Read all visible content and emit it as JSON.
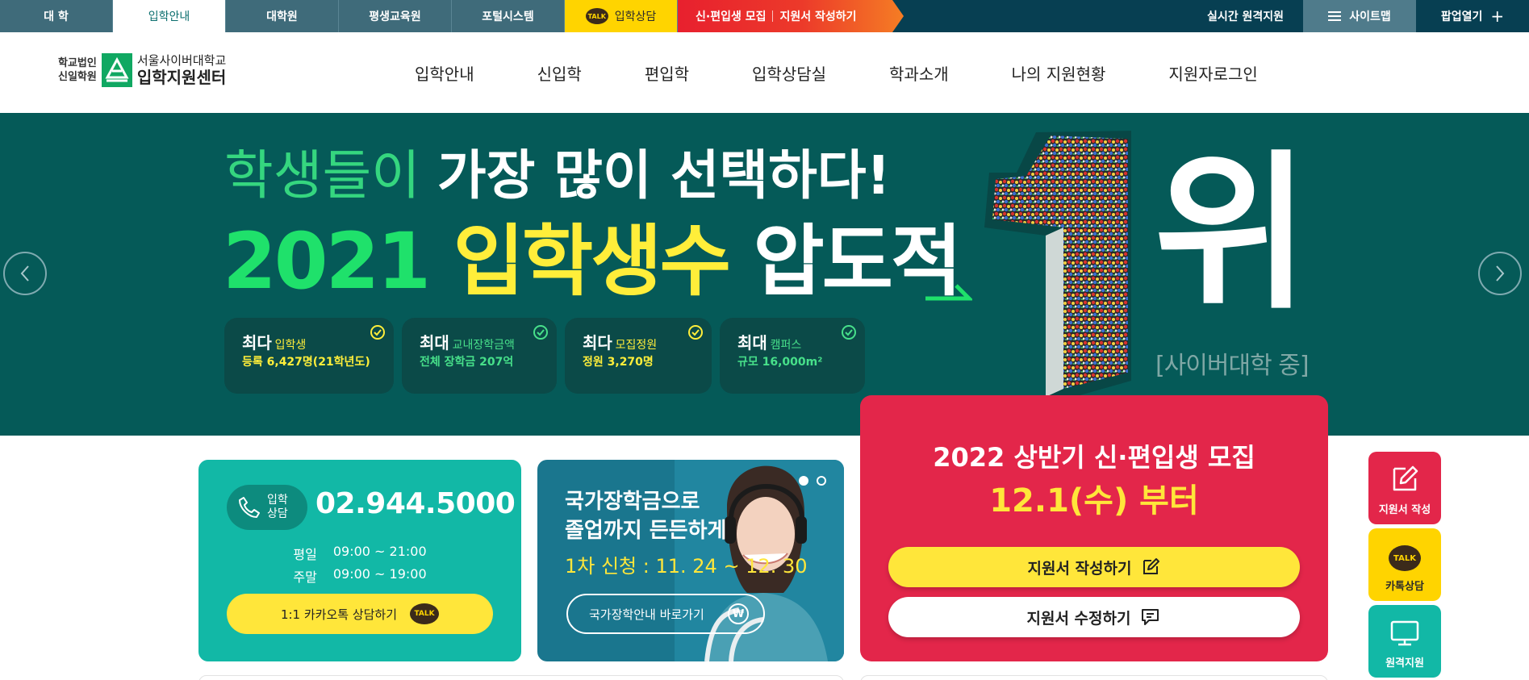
{
  "topbar": {
    "tabs": [
      {
        "label": "대 학"
      },
      {
        "label": "입학안내"
      },
      {
        "label": "대학원"
      },
      {
        "label": "평생교육원"
      },
      {
        "label": "포털시스템"
      }
    ],
    "counsel": {
      "badge": "TALK",
      "label": "입학상담"
    },
    "promo": {
      "recruit": "신·편입생 모집",
      "apply": "지원서 작성하기"
    },
    "remote_apply": "실시간 원격지원",
    "sitemap": "사이트맵",
    "popup": "팝업열기"
  },
  "header": {
    "logo": {
      "corp_line1": "학교법인",
      "corp_line2": "신일학원",
      "university": "서울사이버대학교",
      "center": "입학지원센터"
    },
    "nav": [
      "입학안내",
      "신입학",
      "편입학",
      "입학상담실",
      "학과소개",
      "나의 지원현황",
      "지원자로그인"
    ]
  },
  "hero": {
    "line1_thin": "학생들이",
    "line1_bold": "가장 많이 선택하다!",
    "year": "2021",
    "line2_yellow": "입학생수",
    "line2_white": "압도적",
    "rank_digit": "1",
    "rank_word": "위",
    "rank_note": "[사이버대학 중]",
    "stats": [
      {
        "max": "최다",
        "label": "입학생",
        "value": "등록 6,427명(21학년도)",
        "tone": "yellow"
      },
      {
        "max": "최대",
        "label": "교내장학금액",
        "value": "전체 장학금 207억",
        "tone": "green"
      },
      {
        "max": "최다",
        "label": "모집정원",
        "value": "정원 3,270명",
        "tone": "yellow"
      },
      {
        "max": "최대",
        "label": "캠퍼스",
        "value": "규모 16,000m²",
        "tone": "green"
      }
    ]
  },
  "phone": {
    "pill_line1": "입학",
    "pill_line2": "상담",
    "number": "02.944.5000",
    "hours": [
      {
        "day": "평일",
        "time": "09:00 ~ 21:00"
      },
      {
        "day": "주말",
        "time": "09:00 ~ 19:00"
      }
    ],
    "kakao_label": "1:1 카카오톡 상담하기",
    "kakao_badge": "TALK"
  },
  "scholarship": {
    "head_line1": "국가장학금으로",
    "head_line2": "졸업까지 든든하게",
    "period": "1차 신청 : 11. 24  ~  12. 30",
    "button": "국가장학안내 바로가기",
    "won_symbol": "₩"
  },
  "apply": {
    "title": "2022 상반기 신·편입생 모집",
    "date": "12.1(수) 부터",
    "write_button": "지원서 작성하기",
    "edit_button": "지원서 수정하기"
  },
  "quick_menu": [
    {
      "label": "지원서 작성",
      "icon": "edit-icon"
    },
    {
      "label": "카톡상담",
      "icon": "kakao-talk-icon",
      "badge": "TALK"
    },
    {
      "label": "원격지원",
      "icon": "monitor-icon"
    }
  ],
  "colors": {
    "topbar_bg": "#073f52",
    "hero_bg": "#055a58",
    "accent_green": "#1fe16b",
    "accent_yellow": "#ffee3a",
    "apply_red": "#e3264a",
    "phone_teal": "#12b8a6",
    "scholar_blue": "#1a768e",
    "kakao_yellow": "#ffd400"
  }
}
